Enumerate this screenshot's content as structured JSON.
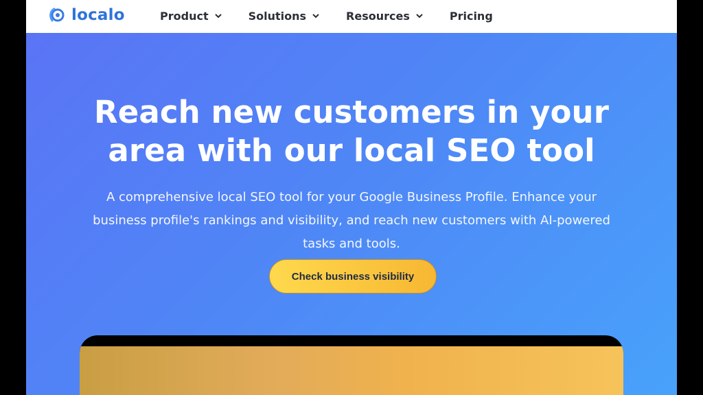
{
  "nav": {
    "logo_text": "localo",
    "items": [
      {
        "label": "Product"
      },
      {
        "label": "Solutions"
      },
      {
        "label": "Resources"
      },
      {
        "label": "Pricing"
      }
    ]
  },
  "hero": {
    "title_line1": "Reach new customers in your",
    "title_line2": "area with our local SEO tool",
    "subtitle_line1": "A comprehensive local SEO tool for your Google Business Profile. Enhance your",
    "subtitle_line2": "business profile's rankings and visibility, and reach new customers with AI-powered",
    "subtitle_line3": "tasks and tools.",
    "cta_label": "Check business visibility"
  },
  "colors": {
    "brand_blue": "#2f73d9",
    "hero_start": "#5a74f5",
    "hero_end": "#48a2fb",
    "cta_start": "#ffd94d",
    "cta_end": "#f7b733"
  }
}
